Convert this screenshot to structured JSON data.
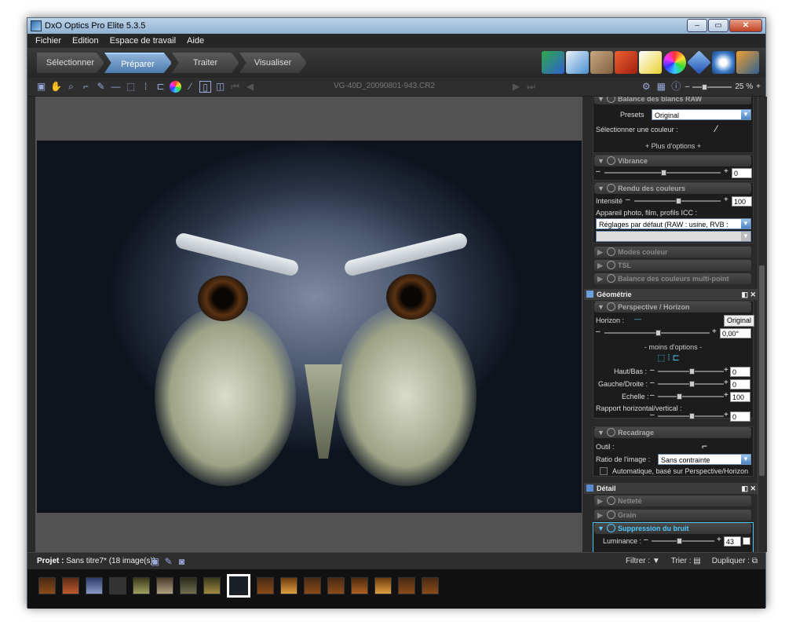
{
  "window": {
    "title": "DxO Optics Pro Elite 5.3.5",
    "min": "–",
    "max": "▭",
    "close": "✕"
  },
  "menu": [
    "Fichier",
    "Edition",
    "Espace de travail",
    "Aide"
  ],
  "tabs": [
    {
      "label": "Sélectionner"
    },
    {
      "label": "Préparer"
    },
    {
      "label": "Traiter"
    },
    {
      "label": "Visualiser"
    }
  ],
  "viewer": {
    "filename": "VG-40D_20090801-943.CR2",
    "zoom": "25 %"
  },
  "panel": {
    "wb": {
      "title": "Balance des blancs RAW",
      "presets_label": "Presets",
      "presets_value": "Original",
      "pick_label": "Sélectionner une couleur :",
      "more": "+ Plus d'options +"
    },
    "vibrance": {
      "title": "Vibrance",
      "value": "0"
    },
    "rendu": {
      "title": "Rendu des couleurs",
      "intensity_label": "Intensité",
      "intensity_value": "100",
      "device_label": "Appareil photo, film, profils ICC :",
      "device_value": "Réglages par défaut (RAW : usine, RVB : boîtier)"
    },
    "collapsed1": [
      "Modes couleur",
      "TSL",
      "Balance des couleurs multi-point"
    ],
    "geometry": {
      "title": "Géométrie",
      "perspective": "Perspective / Horizon",
      "horizon_label": "Horizon :",
      "horizon_btn": "Original",
      "horizon_value": "0,00°",
      "less": "- moins d'options -",
      "haut_label": "Haut/Bas :",
      "haut_value": "0",
      "gauche_label": "Gauche/Droite :",
      "gauche_value": "0",
      "echelle_label": "Echelle :",
      "echelle_value": "100",
      "rapport_label": "Rapport horizontal/vertical :",
      "rapport_value": "0",
      "recadrage": "Recadrage",
      "outil_label": "Outil :",
      "ratio_label": "Ratio de l'image :",
      "ratio_value": "Sans contrainte",
      "auto_label": "Automatique, basé sur Perspective/Horizon"
    },
    "detail": {
      "title": "Détail",
      "items": [
        "Netteté",
        "Grain"
      ],
      "noise": "Suppression du bruit",
      "lum_label": "Luminance :",
      "lum_value": "43"
    }
  },
  "bottom": {
    "project_label": "Projet :",
    "project_value": "Sans titre7* (18 image(s))",
    "filter": "Filtrer :",
    "sort": "Trier :",
    "duplicate": "Dupliquer :"
  },
  "colors": {
    "accent": "#4cc8ff",
    "active_tab": "#5b8bc0"
  }
}
